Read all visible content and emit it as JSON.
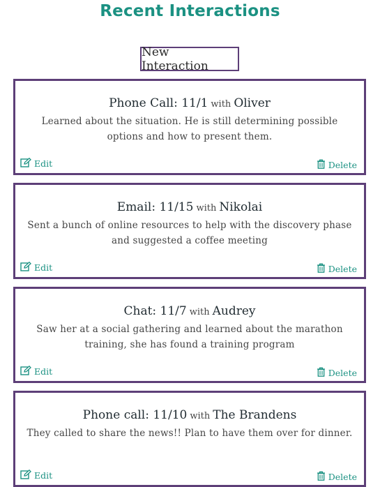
{
  "page": {
    "title": "Recent Interactions"
  },
  "toolbar": {
    "new_label": "New Interaction"
  },
  "colors": {
    "accent": "#1b9182",
    "border": "#5d3f78"
  },
  "interactions": [
    {
      "type_date": "Phone Call: 11/1",
      "with": "with",
      "person": "Oliver",
      "notes": "Learned about the situation. He is still determining possible options and how to present them.",
      "edit_label": "Edit",
      "delete_label": "Delete"
    },
    {
      "type_date": "Email: 11/15",
      "with": "with",
      "person": "Nikolai",
      "notes": "Sent a bunch of online resources to help with the discovery phase and suggested a coffee meeting",
      "edit_label": "Edit",
      "delete_label": "Delete"
    },
    {
      "type_date": "Chat: 11/7",
      "with": "with",
      "person": "Audrey",
      "notes": "Saw her at a social gathering and learned about the marathon training, she has found a training program",
      "edit_label": "Edit",
      "delete_label": "Delete"
    },
    {
      "type_date": "Phone call: 11/10",
      "with": "with",
      "person": "The Brandens",
      "notes": "They called to share the news!! Plan to have them over for dinner.",
      "edit_label": "Edit",
      "delete_label": "Delete"
    }
  ],
  "icons": {
    "edit": "edit-icon",
    "delete": "trash-icon"
  }
}
